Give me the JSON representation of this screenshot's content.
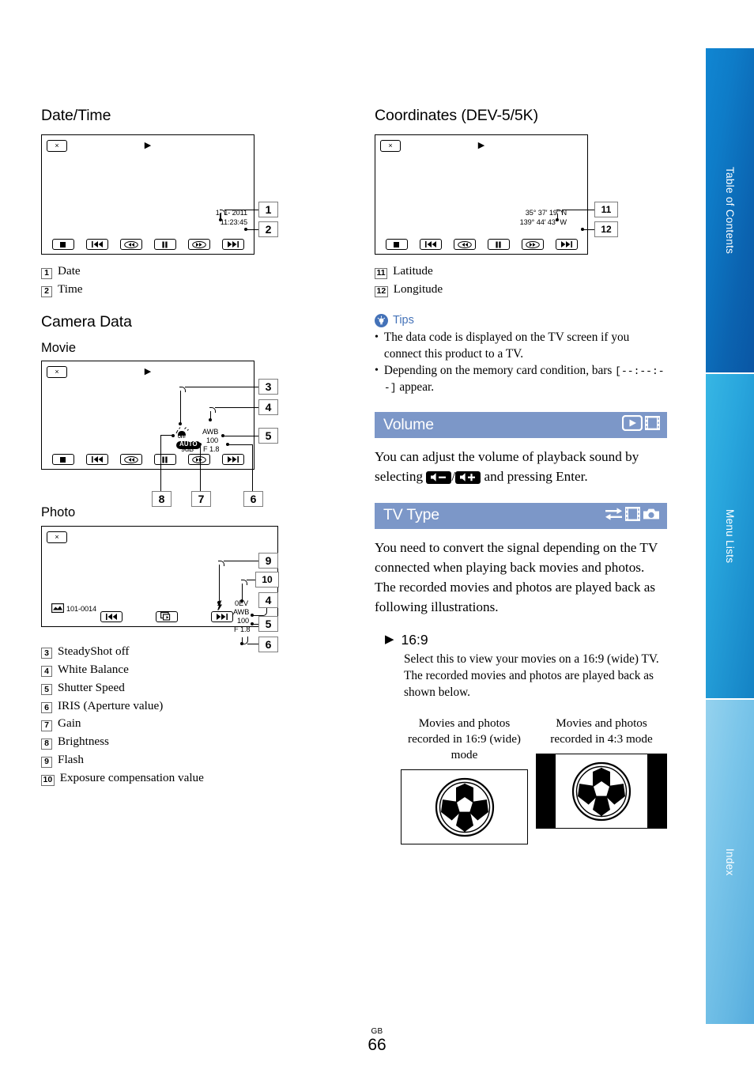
{
  "page": {
    "footer_locale": "GB",
    "footer_number": "66"
  },
  "sidebar": {
    "tabs": [
      {
        "label": "Table of Contents",
        "color": "#0b63b0"
      },
      {
        "label": "Menu Lists",
        "color": "#1b8ecd"
      },
      {
        "label": "Index",
        "color": "#63b6e2"
      }
    ]
  },
  "left_column": {
    "datetime": {
      "heading": "Date/Time",
      "screen": {
        "close_label": "×",
        "play_glyph": "▶",
        "date_value": "1- 1- 2011",
        "time_value": "11:23:45",
        "controls": [
          "■",
          "◀◀|",
          "◀◀",
          "||",
          "▶▶",
          "|▶▶"
        ]
      },
      "callouts": [
        "1",
        "2"
      ],
      "legend": [
        {
          "num": "1",
          "label": "Date"
        },
        {
          "num": "2",
          "label": "Time"
        }
      ]
    },
    "camera_data": {
      "heading": "Camera Data",
      "movie": {
        "subheading": "Movie",
        "close_label": "×",
        "play_glyph": "▶",
        "steadyshot_label": "OFF",
        "white_balance": "AWB",
        "shutter_speed": "100",
        "iris": "F 1.8",
        "gain": "9dB",
        "brightness": "AUTO",
        "callouts": [
          "3",
          "4",
          "5",
          "6",
          "7",
          "8"
        ],
        "controls": [
          "■",
          "◀◀|",
          "◀◀",
          "||",
          "▶▶",
          "|▶▶"
        ]
      },
      "photo": {
        "subheading": "Photo",
        "close_label": "×",
        "flash_glyph": "⚡",
        "exposure_comp": "0EV",
        "white_balance": "AWB",
        "shutter_speed": "100",
        "iris": "F 1.8",
        "file_number": "101-0014",
        "callouts": [
          "9",
          "10",
          "4",
          "5",
          "6"
        ],
        "controls": [
          "◀◀|",
          "↪",
          "|▶▶"
        ]
      },
      "legend": [
        {
          "num": "3",
          "label": "SteadyShot off"
        },
        {
          "num": "4",
          "label": "White Balance"
        },
        {
          "num": "5",
          "label": "Shutter Speed"
        },
        {
          "num": "6",
          "label": "IRIS (Aperture value)"
        },
        {
          "num": "7",
          "label": "Gain"
        },
        {
          "num": "8",
          "label": "Brightness"
        },
        {
          "num": "9",
          "label": "Flash"
        },
        {
          "num": "10",
          "label": "Exposure compensation value"
        }
      ]
    }
  },
  "right_column": {
    "coordinates": {
      "heading": "Coordinates (DEV-5/5K)",
      "screen": {
        "close_label": "×",
        "play_glyph": "▶",
        "latitude_value": "35° 37′ 19″ N",
        "longitude_value": "139° 44′ 43″ W",
        "controls": [
          "■",
          "◀◀|",
          "◀◀",
          "||",
          "▶▶",
          "|▶▶"
        ]
      },
      "callouts": [
        "11",
        "12"
      ],
      "legend": [
        {
          "num": "11",
          "label": "Latitude"
        },
        {
          "num": "12",
          "label": "Longitude"
        }
      ]
    },
    "tips": {
      "title": "Tips",
      "icon": "lightbulb-icon",
      "items": [
        "The data code is displayed on the TV screen if you connect this product to a TV.",
        "Depending on the memory card condition, bars [--:--:--] appear."
      ],
      "item2_prefix": "Depending on the memory card condition, bars",
      "item2_bars": "[--:--:--]",
      "item2_suffix": "appear."
    },
    "volume": {
      "section_title": "Volume",
      "icons": [
        "play-icon",
        "film-strip-icon"
      ],
      "body_prefix": "You can adjust the volume of playback sound by selecting",
      "body_middle": "/",
      "body_suffix": "and pressing Enter.",
      "volume_down_icon": "volume-down-icon",
      "volume_up_icon": "volume-up-icon"
    },
    "tv_type": {
      "section_title": "TV Type",
      "icons": [
        "two-way-arrows-icon",
        "film-strip-icon",
        "camera-icon"
      ],
      "body": "You need to convert the signal depending on the TV connected when playing back movies and photos. The recorded movies and photos are played back as following illustrations.",
      "option": {
        "marker": "▶",
        "label": "16:9",
        "description": "Select this to view your movies on a 16:9 (wide) TV. The recorded movies and photos are played back as shown below."
      },
      "comparison": [
        {
          "caption": "Movies and photos recorded in 16:9 (wide) mode",
          "mode": "16:9",
          "letterbox": false
        },
        {
          "caption": "Movies and photos recorded in 4:3 mode",
          "mode": "4:3",
          "letterbox": true
        }
      ]
    }
  },
  "colors": {
    "section_bar": "#7c97c8",
    "tips_accent": "#4472b8",
    "callout_border": "#7e7e7e"
  }
}
